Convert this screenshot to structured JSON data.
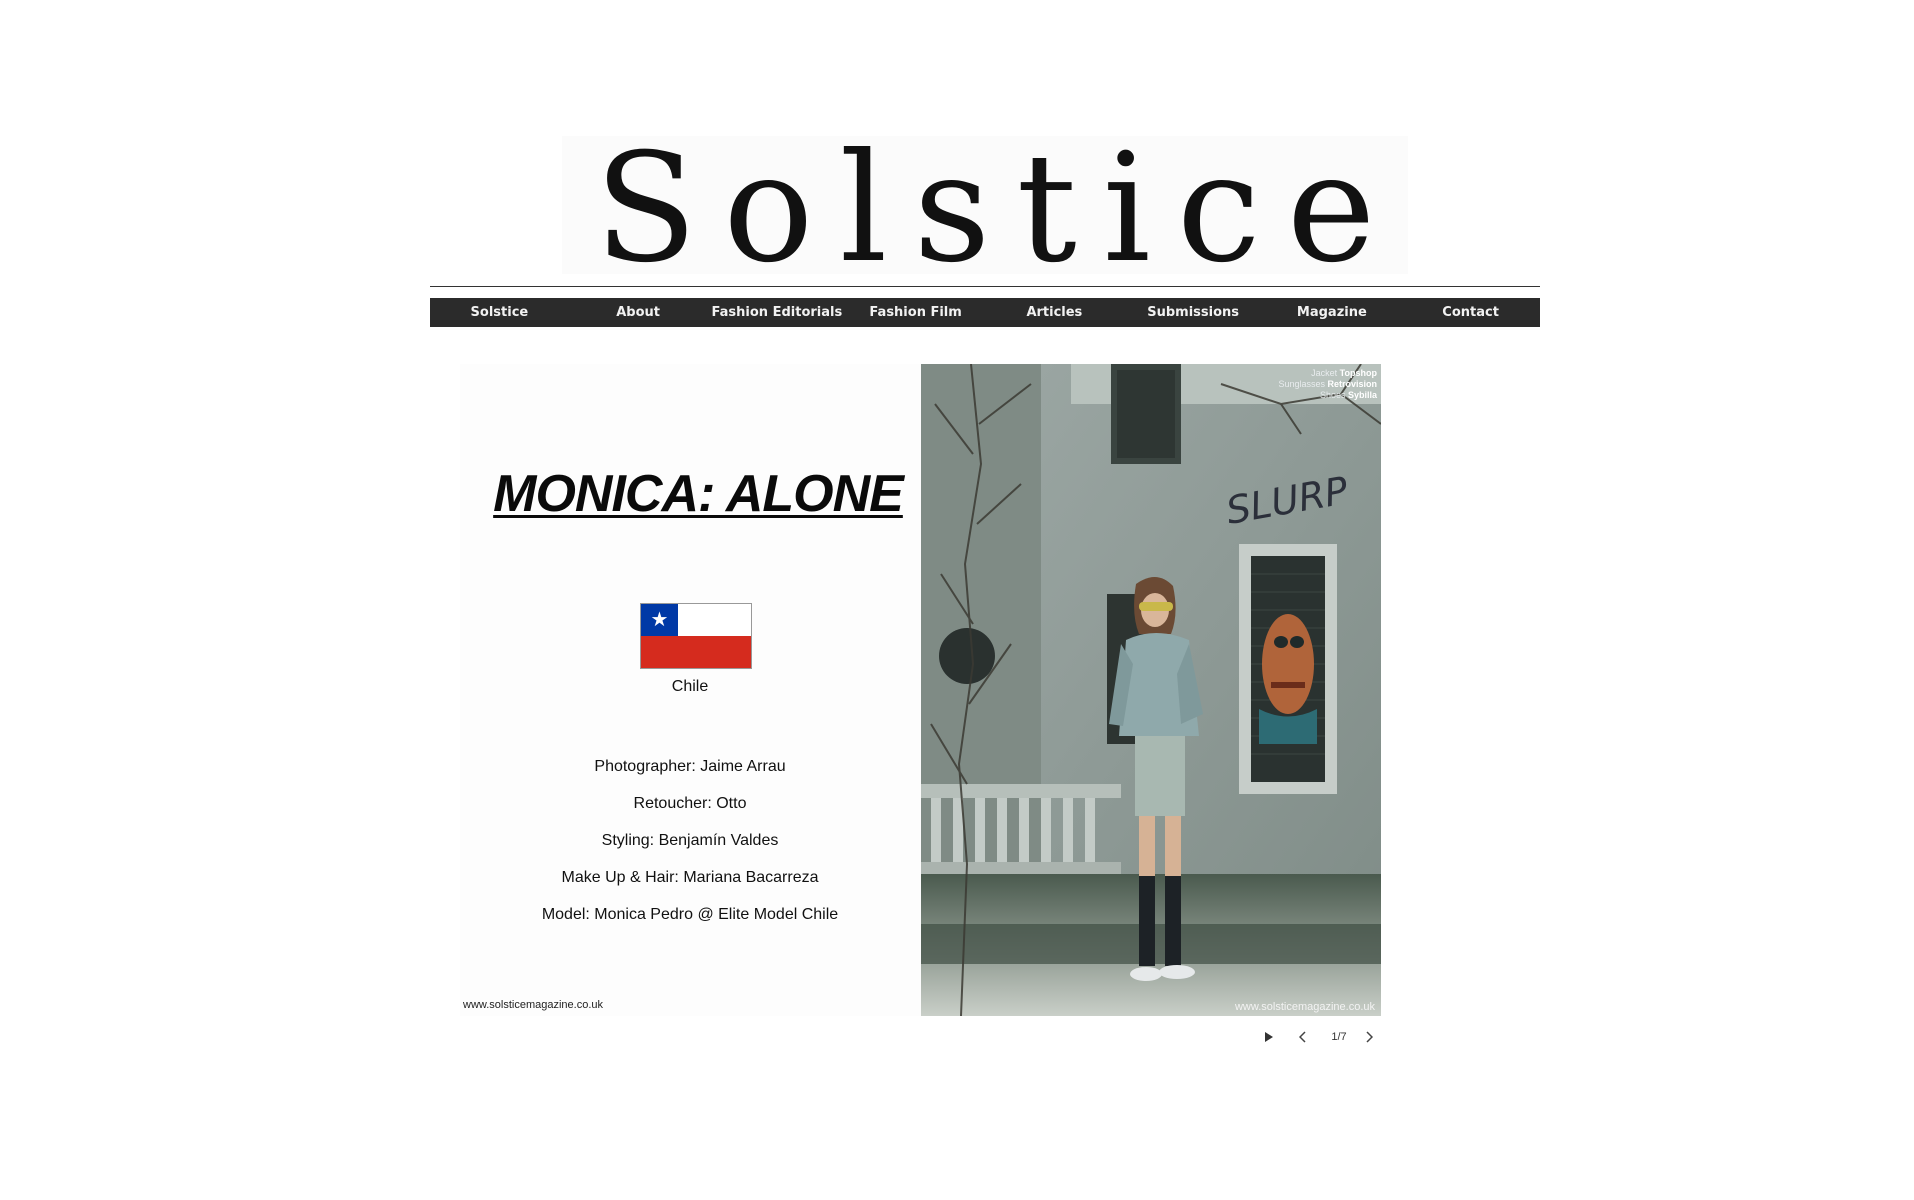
{
  "site": {
    "logo_text": "Solstice"
  },
  "nav": {
    "items": [
      {
        "label": "Solstice"
      },
      {
        "label": "About"
      },
      {
        "label": "Fashion Editorials"
      },
      {
        "label": "Fashion Film"
      },
      {
        "label": "Articles"
      },
      {
        "label": "Submissions"
      },
      {
        "label": "Magazine"
      },
      {
        "label": "Contact"
      }
    ]
  },
  "slide": {
    "title": "MONICA: ALONE",
    "country": "Chile",
    "credits": [
      "Photographer: Jaime Arrau",
      "Retoucher: Otto",
      "Styling: Benjamín Valdes",
      "Make Up & Hair: Mariana Bacarreza",
      "Model: Monica Pedro @ Elite Model Chile"
    ],
    "watermark": "www.solsticemagazine.co.uk",
    "photo_caption": [
      {
        "item": "Jacket",
        "brand": "Topshop"
      },
      {
        "item": "Sunglasses",
        "brand": "Retrovision"
      },
      {
        "item": "Shoes",
        "brand": "Sybilla"
      }
    ],
    "graffiti_text": "SLURP"
  },
  "gallery": {
    "counter": "1/7",
    "icons": {
      "play": "play-icon",
      "prev": "chevron-left-icon",
      "next": "chevron-right-icon"
    }
  },
  "colors": {
    "nav_background": "#2b2b2b",
    "nav_text": "#f2f2f2",
    "flag_blue": "#0039a6",
    "flag_red": "#d52b1e"
  }
}
